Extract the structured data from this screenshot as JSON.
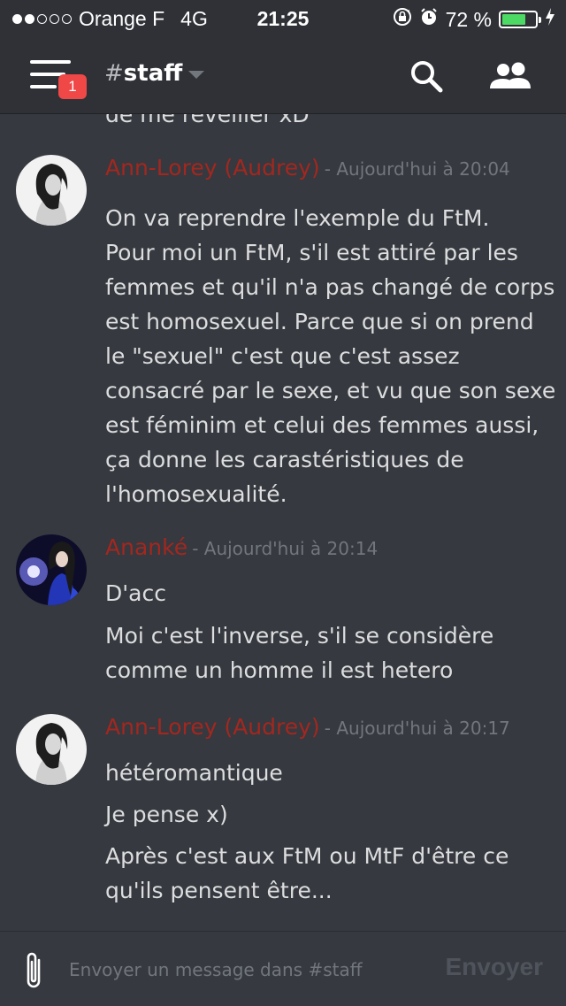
{
  "status_bar": {
    "carrier": "Orange F",
    "network": "4G",
    "time": "21:25",
    "battery": "72 %",
    "battery_level": 0.72,
    "signal_bars_filled": 2,
    "signal_bars_total": 5
  },
  "header": {
    "channel_hash": "#",
    "channel_name": "staff",
    "badge_count": "1"
  },
  "messages": {
    "cutoff_text": "de me réveiller xD",
    "groups": [
      {
        "author": "Ann-Lorey (Audrey)",
        "timestamp": "- Aujourd'hui à 20:04",
        "lines": [
          "On va reprendre l'exemple du FtM.",
          "Pour moi un FtM, s'il est attiré par les",
          "femmes et qu'il n'a pas changé de corps",
          "est homosexuel. Parce que si on prend",
          "le \"sexuel\" c'est que c'est assez",
          "consacré par le sexe, et vu que son sexe",
          "est féminim et celui des femmes aussi,",
          "ça donne les carastéristiques de",
          "l'homosexualité."
        ]
      },
      {
        "author": "Ananké",
        "timestamp": "- Aujourd'hui à 20:14",
        "lines": [
          "D'acc",
          "Moi c'est l'inverse, s'il se considère",
          "comme un homme il est hetero"
        ]
      },
      {
        "author": "Ann-Lorey (Audrey)",
        "timestamp": "- Aujourd'hui à 20:17",
        "lines": [
          "hétéromantique",
          "Je pense x)",
          "Après c'est aux FtM ou MtF d'être ce",
          "qu'ils pensent être..."
        ]
      }
    ]
  },
  "input_bar": {
    "placeholder": "Envoyer un message dans #staff",
    "value": "",
    "send_label": "Envoyer"
  },
  "colors": {
    "background": "#36393f",
    "header_bg": "#2f3136",
    "author": "#a3271f",
    "badge": "#f04747",
    "battery": "#4cd964"
  }
}
